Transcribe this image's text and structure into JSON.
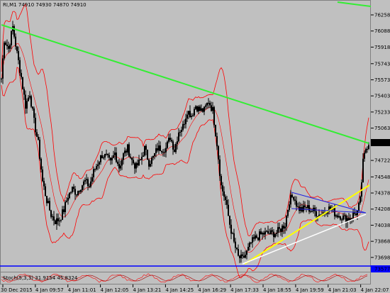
{
  "chart_header": {
    "symbol": "RI,M1",
    "ohlc": "74910 74930 74870 74910"
  },
  "oscillator_label": "Stoch(5,3,3) 31.9154 45.8324",
  "colors": {
    "background": "#c0c0c0",
    "candles": "#000000",
    "bollinger": "#ff0000",
    "trendline_main": "#33ee33",
    "trendline_yellow": "#ffff00",
    "trendline_white": "#ffffff",
    "triangle": "#2222dd",
    "support_line": "#0000ff",
    "price_marker": "#000000"
  },
  "chart_data": {
    "type": "candlestick",
    "symbol": "RI",
    "timeframe": "M1",
    "y_ticks": [
      76258,
      76088,
      75918,
      75743,
      75573,
      75403,
      75233,
      75063,
      74910,
      74722,
      74548,
      74378,
      74208,
      74038,
      73868,
      73698,
      73577
    ],
    "current_price": 74910,
    "support_price": 73577,
    "x_ticks": [
      "30 Dec 2015",
      "4 Jan 09:57",
      "4 Jan 11:01",
      "4 Jan 12:05",
      "4 Jan 13:21",
      "4 Jan 14:25",
      "4 Jan 16:29",
      "4 Jan 17:33",
      "4 Jan 18:55",
      "4 Jan 19:59",
      "4 Jan 21:03",
      "4 Jan 22:07"
    ],
    "price_path": [
      [
        0,
        75380
      ],
      [
        6,
        76000
      ],
      [
        12,
        75900
      ],
      [
        18,
        76130
      ],
      [
        24,
        75850
      ],
      [
        30,
        75600
      ],
      [
        36,
        75300
      ],
      [
        42,
        75430
      ],
      [
        48,
        75130
      ],
      [
        54,
        74900
      ],
      [
        60,
        74500
      ],
      [
        66,
        74300
      ],
      [
        72,
        74150
      ],
      [
        78,
        74080
      ],
      [
        84,
        74100
      ],
      [
        90,
        74200
      ],
      [
        96,
        74350
      ],
      [
        102,
        74420
      ],
      [
        108,
        74380
      ],
      [
        114,
        74450
      ],
      [
        120,
        74500
      ],
      [
        126,
        74450
      ],
      [
        132,
        74600
      ],
      [
        138,
        74700
      ],
      [
        144,
        74780
      ],
      [
        150,
        74760
      ],
      [
        156,
        74690
      ],
      [
        162,
        74800
      ],
      [
        168,
        74650
      ],
      [
        174,
        74780
      ],
      [
        180,
        74850
      ],
      [
        186,
        74720
      ],
      [
        192,
        74650
      ],
      [
        198,
        74720
      ],
      [
        204,
        74850
      ],
      [
        210,
        74700
      ],
      [
        216,
        74750
      ],
      [
        222,
        74850
      ],
      [
        228,
        74850
      ],
      [
        234,
        74850
      ],
      [
        240,
        74970
      ],
      [
        246,
        74830
      ],
      [
        252,
        75030
      ],
      [
        258,
        75080
      ],
      [
        264,
        75250
      ],
      [
        270,
        75200
      ],
      [
        276,
        75300
      ],
      [
        282,
        75250
      ],
      [
        288,
        75250
      ],
      [
        294,
        75350
      ],
      [
        300,
        75250
      ],
      [
        306,
        74900
      ],
      [
        312,
        74450
      ],
      [
        318,
        74300
      ],
      [
        324,
        74050
      ],
      [
        330,
        73850
      ],
      [
        336,
        73700
      ],
      [
        342,
        73680
      ],
      [
        348,
        73750
      ],
      [
        354,
        73850
      ],
      [
        360,
        73900
      ],
      [
        366,
        73930
      ],
      [
        372,
        73950
      ],
      [
        378,
        73950
      ],
      [
        384,
        73950
      ],
      [
        390,
        73960
      ],
      [
        396,
        74000
      ],
      [
        402,
        74050
      ],
      [
        408,
        74300
      ],
      [
        414,
        74350
      ],
      [
        420,
        74220
      ],
      [
        426,
        74200
      ],
      [
        432,
        74230
      ],
      [
        438,
        74200
      ],
      [
        444,
        74180
      ],
      [
        450,
        74150
      ],
      [
        456,
        74170
      ],
      [
        462,
        74220
      ],
      [
        468,
        74200
      ],
      [
        474,
        74150
      ],
      [
        480,
        74140
      ],
      [
        486,
        74110
      ],
      [
        492,
        74110
      ],
      [
        498,
        74150
      ],
      [
        504,
        74180
      ],
      [
        508,
        74300
      ],
      [
        512,
        74700
      ],
      [
        516,
        74850
      ],
      [
        520,
        74910
      ]
    ]
  }
}
